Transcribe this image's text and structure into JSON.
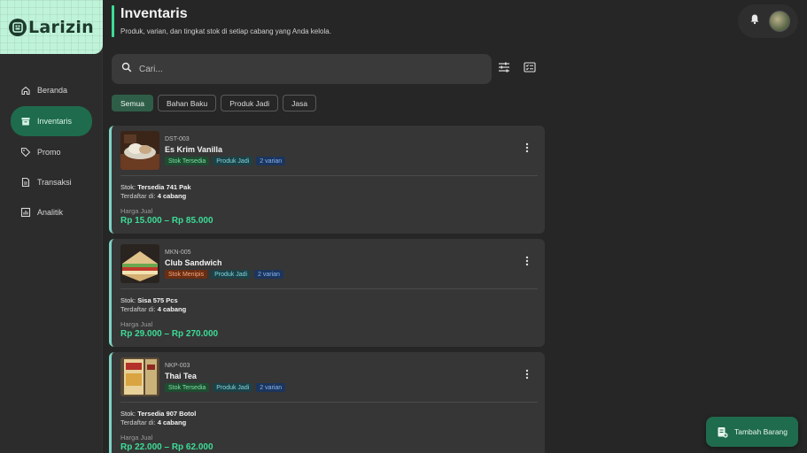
{
  "app": {
    "logo_text": "Larizin"
  },
  "sidebar": {
    "items": [
      {
        "label": "Beranda",
        "icon": "home-icon",
        "active": false
      },
      {
        "label": "Inventaris",
        "icon": "archive-icon",
        "active": true
      },
      {
        "label": "Promo",
        "icon": "tag-icon",
        "active": false
      },
      {
        "label": "Transaksi",
        "icon": "receipt-icon",
        "active": false
      },
      {
        "label": "Analitik",
        "icon": "chart-icon",
        "active": false
      }
    ]
  },
  "header": {
    "title": "Inventaris",
    "subtitle": "Produk, varian, dan tingkat stok di setiap cabang yang Anda kelola."
  },
  "search": {
    "placeholder": "Cari..."
  },
  "filters": [
    "Semua",
    "Bahan Baku",
    "Produk Jadi",
    "Jasa"
  ],
  "products": [
    {
      "sku": "DST-003",
      "name": "Es Krim Vanilla",
      "stock_status": "Stok Tersedia",
      "type": "Produk Jadi",
      "variants": "2 varian",
      "stok_label": "Stok:",
      "stok_value": "Tersedia 741 Pak",
      "cabang_label": "Terdaftar di:",
      "cabang_value": "4 cabang",
      "price_label": "Harga Jual",
      "price": "Rp 15.000 – Rp 85.000"
    },
    {
      "sku": "MKN-005",
      "name": "Club Sandwich",
      "stock_status": "Stok Menipis",
      "type": "Produk Jadi",
      "variants": "2 varian",
      "stok_label": "Stok:",
      "stok_value": "Sisa 575 Pcs",
      "cabang_label": "Terdaftar di:",
      "cabang_value": "4 cabang",
      "price_label": "Harga Jual",
      "price": "Rp 29.000 – Rp 270.000"
    },
    {
      "sku": "NKP-003",
      "name": "Thai Tea",
      "stock_status": "Stok Tersedia",
      "type": "Produk Jadi",
      "variants": "2 varian",
      "stok_label": "Stok:",
      "stok_value": "Tersedia 907 Botol",
      "cabang_label": "Terdaftar di:",
      "cabang_value": "4 cabang",
      "price_label": "Harga Jual",
      "price": "Rp 22.000 – Rp 62.000"
    }
  ],
  "fab": {
    "label": "Tambah Barang"
  },
  "colors": {
    "accent": "#3ddc97",
    "active_nav": "#1f6b4d",
    "background": "#262626"
  }
}
